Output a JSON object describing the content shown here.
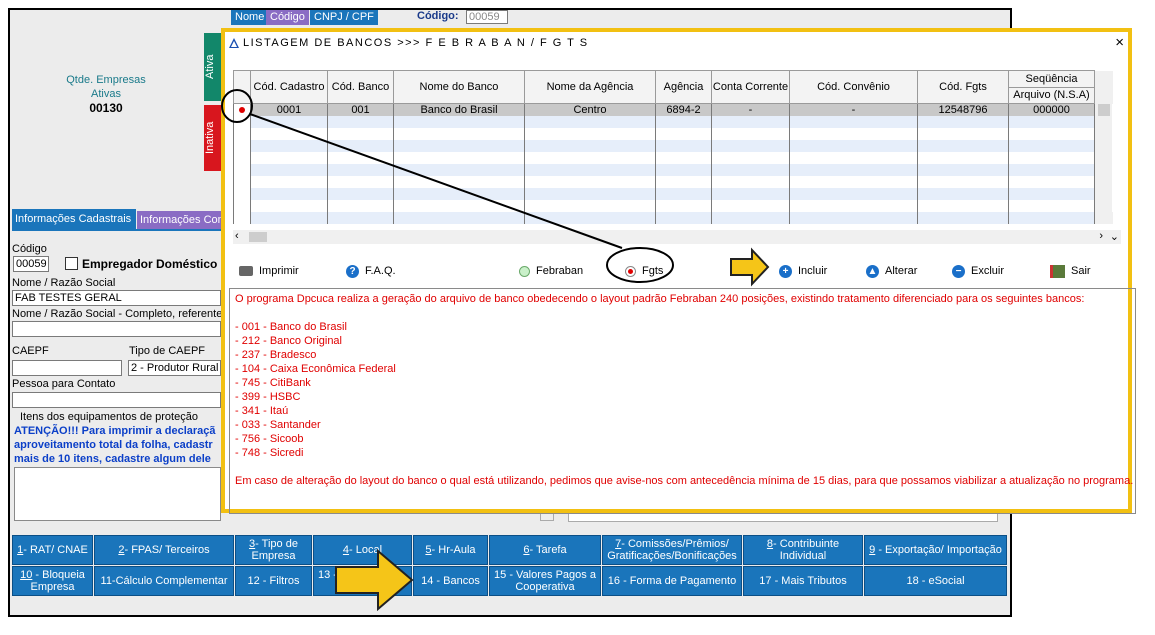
{
  "header": {
    "tab_nome": "Nome",
    "tab_codigo": "Código",
    "tab_cnpj": "CNPJ / CPF",
    "codigo_label": "Código:",
    "codigo_value": "00059"
  },
  "summary": {
    "label1": "Qtde. Empresas",
    "label2": "Ativas",
    "value": "00130",
    "tab_ativa": "Ativa",
    "tab_inativa": "Inativa"
  },
  "form": {
    "tab_cadastrais": "Informações Cadastrais",
    "tab_complementares": "Informações Com",
    "codigo_label": "Código",
    "codigo_value": "00059",
    "empregador_domestico": "Empregador Doméstico",
    "nome_label": "Nome / Razão Social",
    "nome_value": "FAB  TESTES GERAL",
    "nome_completo_label": "Nome / Razão Social - Completo, referente",
    "caepf_label": "CAEPF",
    "tipo_caepf_label": "Tipo de CAEPF",
    "tipo_caepf_value": "2 - Produtor Rural",
    "contato_label": "Pessoa para Contato",
    "epi_label": "Itens dos equipamentos de proteção",
    "attention_line1": "ATENÇÃO!!! Para imprimir a declaraçã",
    "attention_line2": "aproveitamento total da folha, cadastr",
    "attention_line3": "mais de 10 itens, cadastre algum dele"
  },
  "bottom_buttons": {
    "row1": [
      {
        "key": "1",
        "text": "- RAT/ CNAE"
      },
      {
        "key": "2",
        "text": "- FPAS/ Terceiros"
      },
      {
        "key": "3",
        "text": "- Tipo de Empresa"
      },
      {
        "key": "4",
        "text": "- Local"
      },
      {
        "key": "5",
        "text": "- Hr-Aula"
      },
      {
        "key": "6",
        "text": "- Tarefa"
      },
      {
        "key": "7",
        "text": "- Comissões/Prêmios/ Gratificações/Bonificações"
      },
      {
        "key": "8",
        "text": "- Contribuinte Individual"
      },
      {
        "key": "9",
        "text": " - Exportação/ Importação"
      }
    ],
    "row2": [
      {
        "key": "10",
        "text": " - Bloqueia Empresa"
      },
      {
        "key": "",
        "text": "11-Cálculo Complementar"
      },
      {
        "key": "",
        "text": "12 - Filtros"
      },
      {
        "key": "",
        "text": "13 -"
      },
      {
        "key": "",
        "text": "14 - Bancos"
      },
      {
        "key": "",
        "text": "15 - Valores Pagos a Cooperativa"
      },
      {
        "key": "",
        "text": "16 - Forma de Pagamento"
      },
      {
        "key": "",
        "text": "17 - Mais Tributos"
      },
      {
        "key": "",
        "text": "18 - eSocial"
      }
    ]
  },
  "dialog": {
    "title": "LISTAGEM DE BANCOS  >>>  F E B R A B A N  /  F G T S",
    "close": "×",
    "columns": [
      "Cód. Cadastro",
      "Cód. Banco",
      "Nome do Banco",
      "Nome da Agência",
      "Agência",
      "Conta Corrente",
      "Cód. Convênio",
      "Cód. Fgts",
      "Seqüência",
      "Arquivo (N.S.A)"
    ],
    "rows": [
      [
        "0001",
        "001",
        "Banco do Brasil",
        "Centro",
        "6894-2",
        "-",
        "-",
        "12548796",
        "000000"
      ]
    ],
    "toolbar": {
      "imprimir": "Imprimir",
      "faq": "F.A.Q.",
      "febraban": "Febraban",
      "fgts": "Fgts",
      "incluir": "Incluir",
      "alterar": "Alterar",
      "excluir": "Excluir",
      "sair": "Sair"
    },
    "memo": {
      "intro": "O programa Dpcuca realiza a geração do arquivo de banco obedecendo o layout padrão Febraban 240 posições, existindo tratamento diferenciado para os seguintes bancos:",
      "banks": [
        "- 001 - Banco do Brasil",
        "- 212 - Banco Original",
        "- 237 - Bradesco",
        "- 104 - Caixa Econômica Federal",
        "- 745 - CitiBank",
        "- 399 - HSBC",
        "- 341 - Itaú",
        "- 033 - Santander",
        "- 756 - Sicoob",
        "- 748 - Sicredi"
      ],
      "footer": "Em caso de alteração do layout do banco o qual está utilizando, pedimos que avise-nos com antecedência mínima de 15 dias, para que possamos viabilizar a atualização no programa."
    }
  },
  "colors": {
    "dialog_border": "#f2c012",
    "button_blue": "#1a75bb",
    "memo_text": "#e00000",
    "arrow_fill": "#f5c518"
  }
}
